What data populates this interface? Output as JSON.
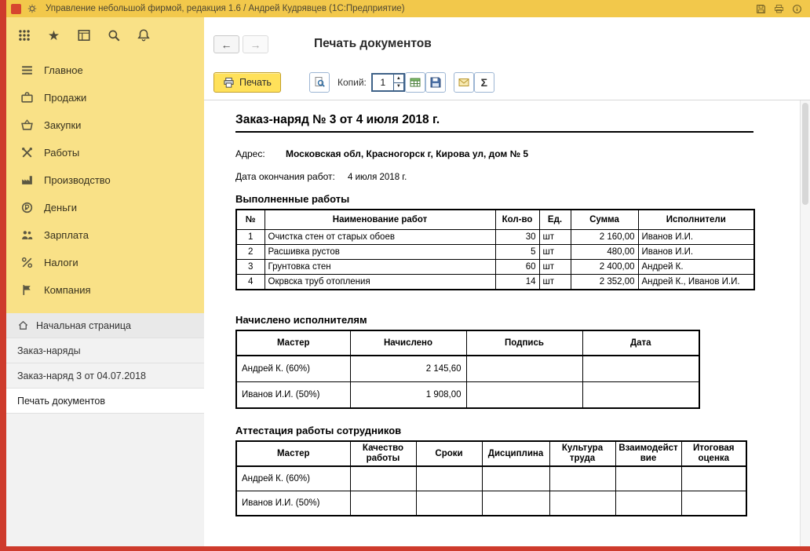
{
  "window": {
    "title": "Управление небольшой фирмой, редакция 1.6 / Андрей Кудрявцев  (1С:Предприятие)"
  },
  "colors": {
    "titlebar": "#f2c84b",
    "sidebar_panel": "#f9e187",
    "edge_red": "#ce3b2c",
    "print_button_bg": "#ffe15a",
    "accent_blue_border": "#9db6d4"
  },
  "sidebar": {
    "sections": [
      {
        "id": "main",
        "label": "Главное",
        "icon": "menu-icon"
      },
      {
        "id": "sales",
        "label": "Продажи",
        "icon": "briefcase-icon"
      },
      {
        "id": "purchases",
        "label": "Закупки",
        "icon": "basket-icon"
      },
      {
        "id": "works",
        "label": "Работы",
        "icon": "tools-icon"
      },
      {
        "id": "production",
        "label": "Производство",
        "icon": "factory-icon"
      },
      {
        "id": "money",
        "label": "Деньги",
        "icon": "coin-icon"
      },
      {
        "id": "salary",
        "label": "Зарплата",
        "icon": "people-icon"
      },
      {
        "id": "taxes",
        "label": "Налоги",
        "icon": "percent-icon"
      },
      {
        "id": "company",
        "label": "Компания",
        "icon": "flag-icon"
      }
    ],
    "nav": [
      {
        "id": "home",
        "label": "Начальная страница",
        "icon": "home-icon",
        "active": false
      },
      {
        "id": "orders",
        "label": "Заказ-наряды",
        "active": false
      },
      {
        "id": "order-3",
        "label": "Заказ-наряд 3 от 04.07.2018",
        "active": false
      },
      {
        "id": "print-doc",
        "label": "Печать документов",
        "active": true
      }
    ]
  },
  "header": {
    "title": "Печать документов"
  },
  "toolbar": {
    "print_label": "Печать",
    "copies_label": "Копий:",
    "copies_value": "1"
  },
  "document": {
    "title": "Заказ-наряд № 3 от 4 июля 2018 г.",
    "address_label": "Адрес:",
    "address_value": "Московская обл, Красногорск г, Кирова ул, дом № 5",
    "end_date_label": "Дата окончания работ:",
    "end_date_value": "4 июля 2018 г.",
    "works": {
      "heading": "Выполненные работы",
      "headers": [
        "№",
        "Наименование работ",
        "Кол-во",
        "Ед.",
        "Сумма",
        "Исполнители"
      ],
      "rows": [
        [
          "1",
          "Очистка стен от старых обоев",
          "30",
          "шт",
          "2 160,00",
          "Иванов И.И."
        ],
        [
          "2",
          "Расшивка рустов",
          "5",
          "шт",
          "480,00",
          "Иванов И.И."
        ],
        [
          "3",
          "Грунтовка стен",
          "60",
          "шт",
          "2 400,00",
          "Андрей К."
        ],
        [
          "4",
          "Окрвска труб отопления",
          "14",
          "шт",
          "2 352,00",
          "Андрей К., Иванов И.И."
        ]
      ]
    },
    "accruals": {
      "heading": "Начислено исполнителям",
      "headers": [
        "Мастер",
        "Начислено",
        "Подпись",
        "Дата"
      ],
      "rows": [
        [
          "Андрей К. (60%)",
          "2 145,60",
          "",
          ""
        ],
        [
          "Иванов И.И. (50%)",
          "1 908,00",
          "",
          ""
        ]
      ]
    },
    "attestation": {
      "heading": "Аттестация работы сотрудников",
      "headers": [
        "Мастер",
        "Качество работы",
        "Сроки",
        "Дисциплина",
        "Культура труда",
        "Взаимодействие",
        "Итоговая оценка"
      ],
      "rows": [
        [
          "Андрей К. (60%)",
          "",
          "",
          "",
          "",
          "",
          ""
        ],
        [
          "Иванов И.И. (50%)",
          "",
          "",
          "",
          "",
          "",
          ""
        ]
      ]
    }
  }
}
